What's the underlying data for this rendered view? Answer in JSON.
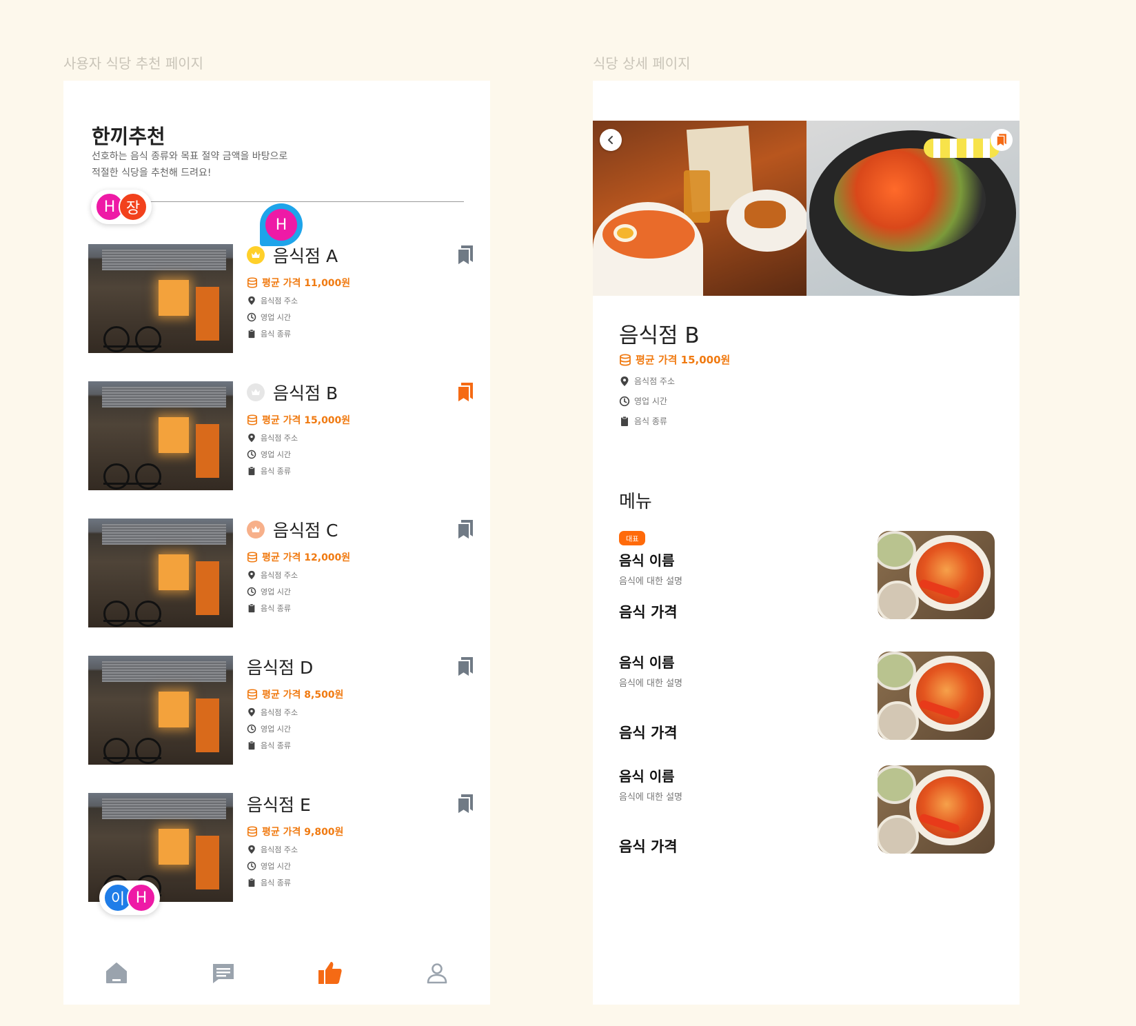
{
  "labels": {
    "left_frame": "사용자 식당 추천 페이지",
    "right_frame": "식당 상세 페이지"
  },
  "recommend": {
    "title": "한끼추천",
    "subtitle_line1": "선호하는 음식 종류와 목표 절약 금액을 바탕으로",
    "subtitle_line2": "적절한 식당을 추천해 드려요!",
    "restaurants": [
      {
        "name": "음식점 A",
        "price": "평균 가격 11,000원",
        "address": "음식점 주소",
        "hours": "영업 시간",
        "category": "음식 종류",
        "rank": "gold",
        "bookmarked": false
      },
      {
        "name": "음식점 B",
        "price": "평균 가격 15,000원",
        "address": "음식점 주소",
        "hours": "영업 시간",
        "category": "음식 종류",
        "rank": "silver",
        "bookmarked": true
      },
      {
        "name": "음식점 C",
        "price": "평균 가격 12,000원",
        "address": "음식점 주소",
        "hours": "영업 시간",
        "category": "음식 종류",
        "rank": "bronze",
        "bookmarked": false
      },
      {
        "name": "음식점 D",
        "price": "평균 가격 8,500원",
        "address": "음식점 주소",
        "hours": "영업 시간",
        "category": "음식 종류",
        "rank": "none",
        "bookmarked": false
      },
      {
        "name": "음식점 E",
        "price": "평균 가격 9,800원",
        "address": "음식점 주소",
        "hours": "영업 시간",
        "category": "음식 종류",
        "rank": "none",
        "bookmarked": false
      }
    ]
  },
  "collaborators": {
    "top_group": [
      "H",
      "장"
    ],
    "cursor": "H",
    "bottom_group": [
      "이",
      "H"
    ]
  },
  "bottom_nav": [
    {
      "icon": "home-icon",
      "active": false
    },
    {
      "icon": "chat-icon",
      "active": false
    },
    {
      "icon": "thumbs-up-icon",
      "active": true
    },
    {
      "icon": "user-icon",
      "active": false
    }
  ],
  "detail": {
    "name": "음식점 B",
    "price": "평균 가격 15,000원",
    "address": "음식점 주소",
    "hours": "영업 시간",
    "category": "음식 종류",
    "menu_title": "메뉴",
    "menu": [
      {
        "badge": "대표",
        "name": "음식 이름",
        "desc": "음식에 대한 설명",
        "price": "음식 가격"
      },
      {
        "badge": "",
        "name": "음식 이름",
        "desc": "음식에 대한 설명",
        "price": "음식 가격"
      },
      {
        "badge": "",
        "name": "음식 이름",
        "desc": "음식에 대한 설명",
        "price": "음식 가격"
      }
    ]
  },
  "colors": {
    "accent": "#f07a11",
    "background": "#fdf8ec",
    "icon_gray": "#707a85"
  }
}
